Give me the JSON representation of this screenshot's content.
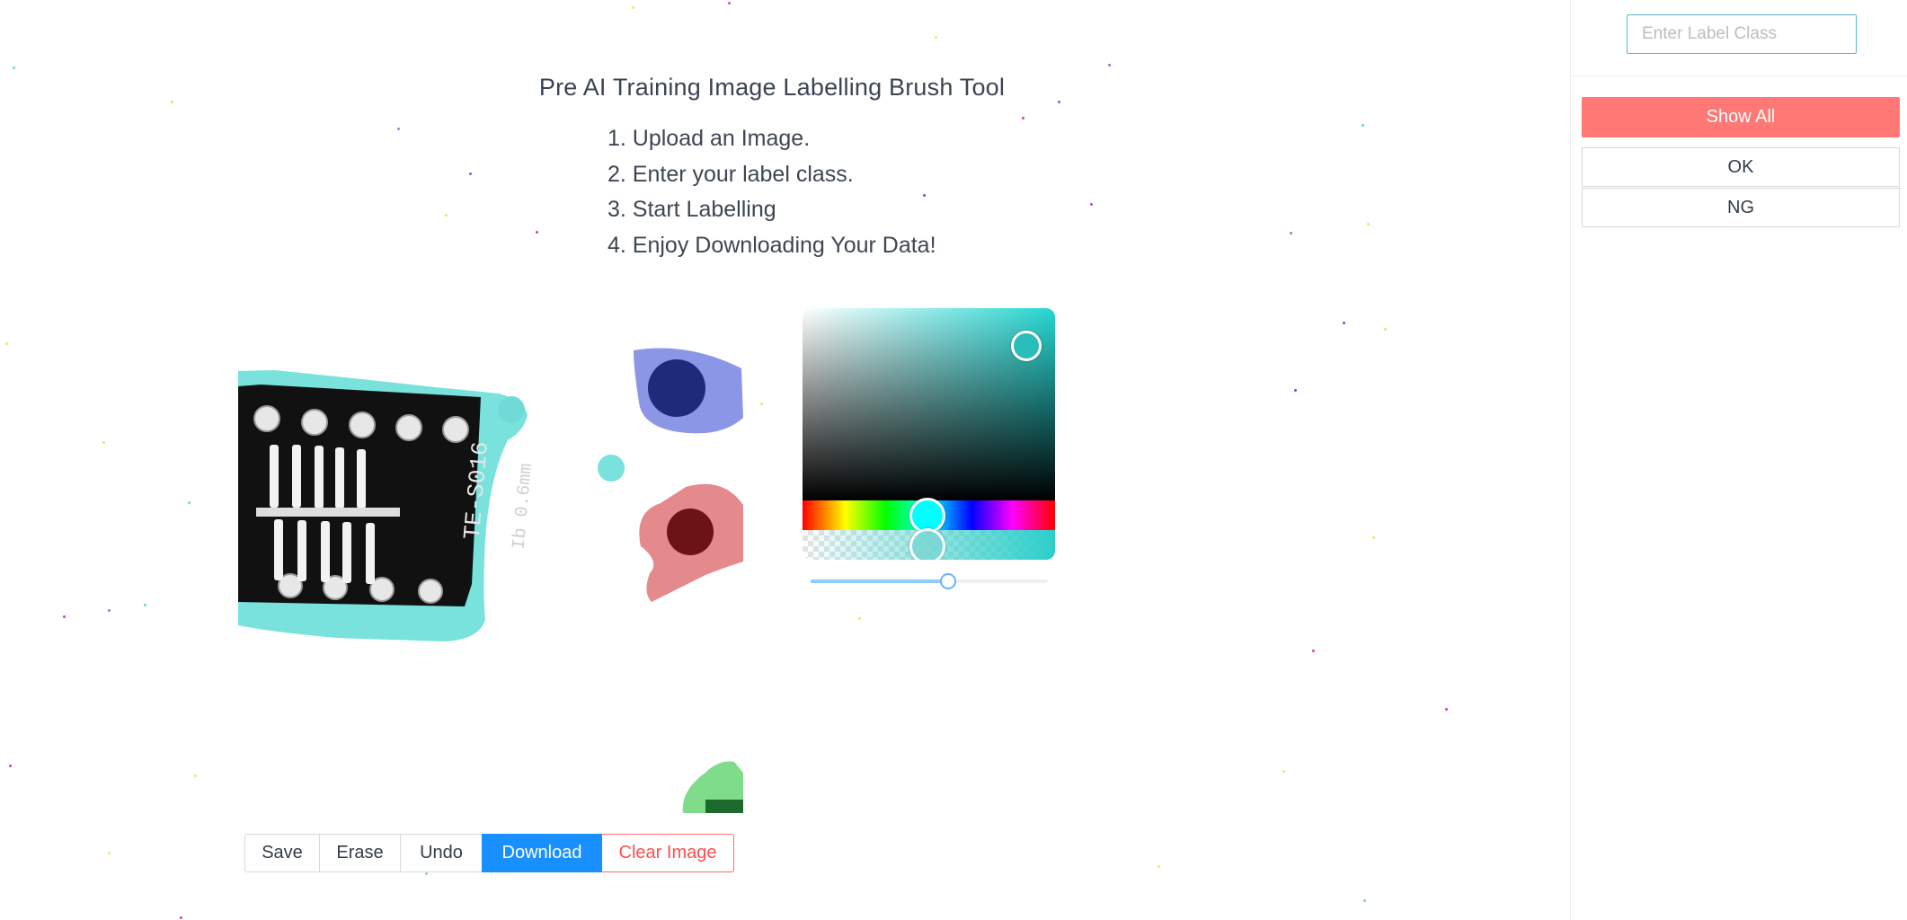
{
  "title": "Pre AI Training Image Labelling Brush Tool",
  "steps": [
    "1. Upload an Image.",
    "2. Enter your label class.",
    "3. Start Labelling",
    "4. Enjoy Downloading Your Data!"
  ],
  "toolbar": {
    "save_label": "Save",
    "erase_label": "Erase",
    "undo_label": "Undo",
    "download_label": "Download",
    "clear_label": "Clear Image"
  },
  "color_picker": {
    "selected_color": "#2bceca",
    "hue_color": "#00ffff"
  },
  "brush_size": {
    "fraction": 0.58
  },
  "sidebar": {
    "label_input_placeholder": "Enter Label Class",
    "label_input_value": "",
    "show_all_label": "Show All",
    "classes": [
      "OK",
      "NG"
    ]
  },
  "colors": {
    "primary": "#1890ff",
    "danger": "#ff4d4f",
    "show_all": "#ff7875",
    "teal_mask": "#79e2dd",
    "blue_mask": "#8c96e6",
    "red_mask": "#e48a8d",
    "green_mask": "#7fdc8b"
  }
}
